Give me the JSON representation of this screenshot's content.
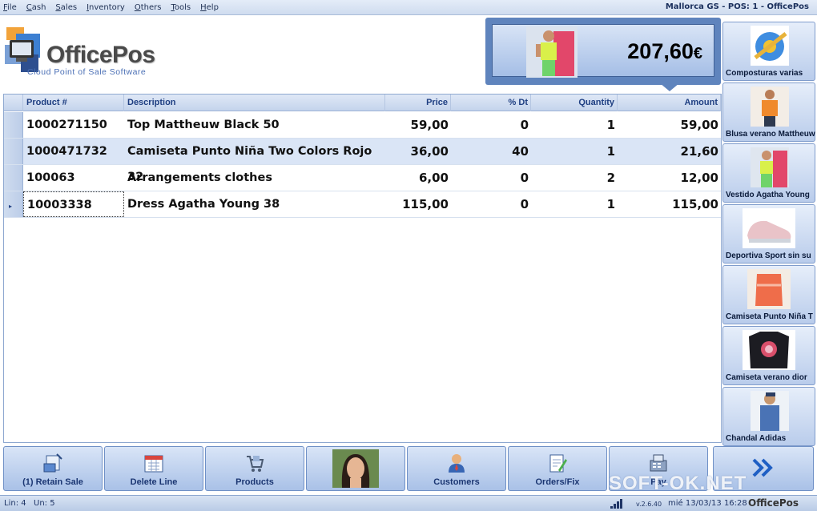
{
  "menu": [
    "File",
    "Cash",
    "Sales",
    "Inventory",
    "Others",
    "Tools",
    "Help"
  ],
  "window_title": "Mallorca GS - POS: 1 - OfficePos",
  "logo": {
    "brand": "OfficePos",
    "tagline": "Cloud Point of Sale Software"
  },
  "total_display": {
    "amount": "207,60",
    "currency": "€"
  },
  "table": {
    "headers": {
      "product": "Product #",
      "description": "Description",
      "price": "Price",
      "discount": "% Dt",
      "quantity": "Quantity",
      "amount": "Amount"
    },
    "rows": [
      {
        "product": "1000271150",
        "description": "Top Mattheuw Black 50",
        "price": "59,00",
        "discount": "0",
        "quantity": "1",
        "amount": "59,00"
      },
      {
        "product": "1000471732",
        "description": "Camiseta Punto Niña Two Colors Rojo 32",
        "price": "36,00",
        "discount": "40",
        "quantity": "1",
        "amount": "21,60"
      },
      {
        "product": "100063",
        "description": "Arrangements clothes",
        "price": "6,00",
        "discount": "0",
        "quantity": "2",
        "amount": "12,00"
      },
      {
        "product": "10003338",
        "description": "Dress Agatha Young 38",
        "price": "115,00",
        "discount": "0",
        "quantity": "1",
        "amount": "115,00"
      }
    ],
    "current_row_marker": "▸"
  },
  "products": [
    {
      "label": "Composturas varias",
      "icon": "tape-measure-icon"
    },
    {
      "label": "Blusa verano Mattheuw",
      "icon": "blouse-photo"
    },
    {
      "label": "Vestido Agatha Young",
      "icon": "dress-photo"
    },
    {
      "label": "Deportiva Sport sin su",
      "icon": "sneaker-photo"
    },
    {
      "label": "Camiseta Punto Niña T",
      "icon": "knit-top-photo"
    },
    {
      "label": "Camiseta verano dior",
      "icon": "tshirt-photo"
    },
    {
      "label": "Chandal Adidas",
      "icon": "tracksuit-photo"
    }
  ],
  "actions": [
    {
      "label": "(1) Retain Sale",
      "icon": "retain-sale-icon"
    },
    {
      "label": "Delete Line",
      "icon": "delete-line-icon"
    },
    {
      "label": "Products",
      "icon": "products-cart-icon"
    },
    {
      "label": "",
      "icon": "salesperson-photo"
    },
    {
      "label": "Customers",
      "icon": "customer-icon"
    },
    {
      "label": "Orders/Fix",
      "icon": "orders-icon"
    },
    {
      "label": "Pay",
      "icon": "pay-register-icon"
    },
    {
      "label": "",
      "icon": "next-arrows-icon"
    }
  ],
  "status": {
    "lines": "Lin: 4",
    "units": "Un: 5",
    "version": "v.2.6.40",
    "datetime": "mié 13/03/13 16:28",
    "brand": "OfficePos"
  },
  "watermark": "SOFT-OK.NET",
  "colors": {
    "accent": "#5f84bd",
    "header_text": "#1f3f82",
    "alt_row": "#dae5f6"
  }
}
